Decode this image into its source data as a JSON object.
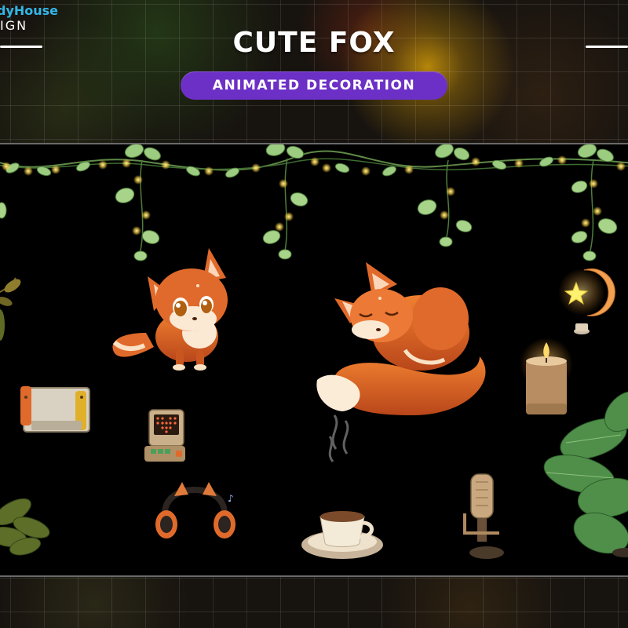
{
  "brand": {
    "line1": "dyHouse",
    "line2": "IGN"
  },
  "header": {
    "title": "CUTE FOX",
    "subtitle": "ANIMATED DECORATION"
  },
  "colors": {
    "pill": "#6d30c6",
    "fox": "#e06a2b",
    "leaf": "#7fbf6a",
    "light": "#ffe27a",
    "background": "#000000"
  },
  "scene": {
    "items": [
      "vine-garland-icon",
      "sitting-fox-icon",
      "sleeping-fox-icon",
      "moon-star-lamp-icon",
      "candle-icon",
      "monstera-plant-icon",
      "game-console-icon",
      "retro-gadget-icon",
      "cat-ear-headphones-icon",
      "coffee-cup-icon",
      "microphone-icon",
      "potted-plant-icon"
    ]
  }
}
